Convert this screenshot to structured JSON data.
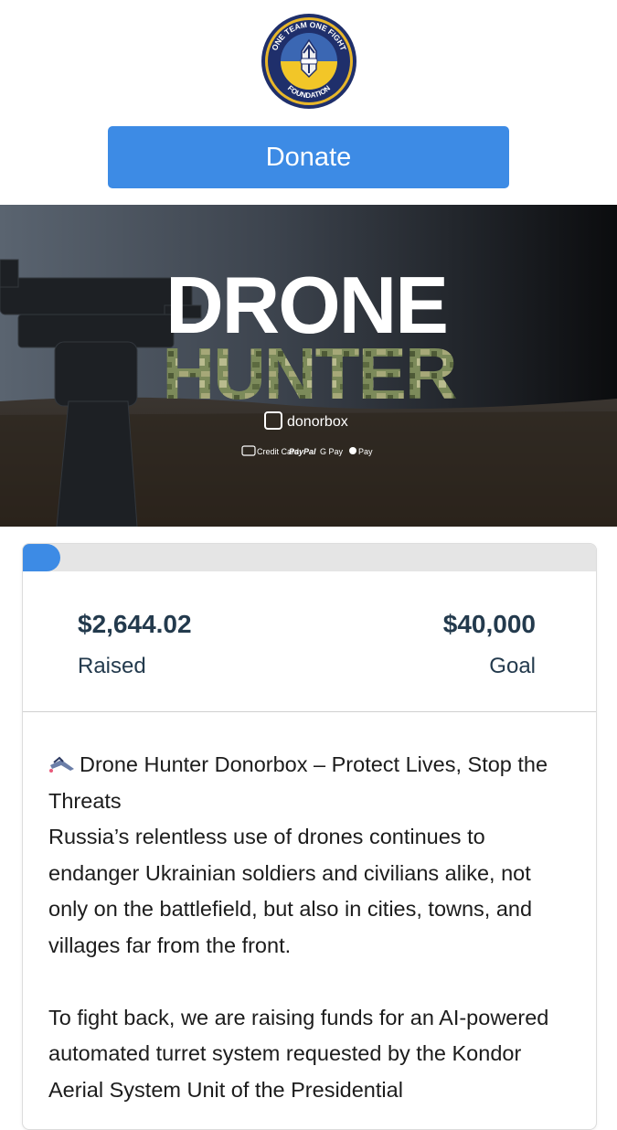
{
  "header": {
    "logo_text_top": "ONE TEAM ONE FIGHT",
    "logo_text_bottom": "FOUNDATION",
    "donate_label": "Donate"
  },
  "banner": {
    "title_line1": "DRONE",
    "title_line2": "HUNTER",
    "brand": "donorbox",
    "payments": [
      "Credit Card",
      "PayPal",
      "G Pay",
      "Pay"
    ]
  },
  "campaign": {
    "progress_percent": 6.6,
    "raised_amount": "$2,644.02",
    "raised_label": "Raised",
    "goal_amount": "$40,000",
    "goal_label": "Goal"
  },
  "description": {
    "emoji_icon": "drone-emoji-icon",
    "heading": "Drone Hunter Donorbox – Protect Lives, Stop the Threats",
    "para1": "Russia’s relentless use of drones continues to endanger Ukrainian soldiers and civilians alike, not only on the battlefield, but also in cities, towns, and villages far from the front.",
    "para2": "To fight back, we are raising funds for an AI-powered automated turret system requested by the Kondor Aerial System Unit of the Presidential"
  },
  "colors": {
    "accent": "#3d8be5",
    "amount_text": "#233a4d",
    "track": "#e5e5e5"
  }
}
